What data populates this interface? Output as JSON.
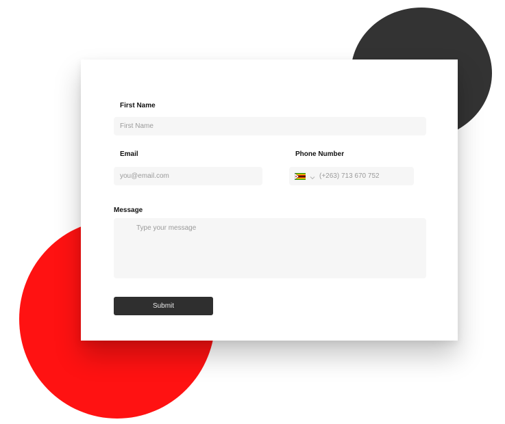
{
  "form": {
    "first_name_label": "First Name",
    "first_name_placeholder": "First Name",
    "email_label": "Email",
    "email_placeholder": "you@email.com",
    "phone_label": "Phone Number",
    "phone_country_flag": "zimbabwe-flag-icon",
    "phone_placeholder": "(+263) 713 670 752",
    "message_label": "Message",
    "message_placeholder": "Type your message",
    "submit_label": "Submit"
  },
  "colors": {
    "dark_circle": "#333333",
    "red_circle": "#ff1212",
    "submit_button": "#2f2f2f",
    "field_background": "#f6f6f6"
  }
}
